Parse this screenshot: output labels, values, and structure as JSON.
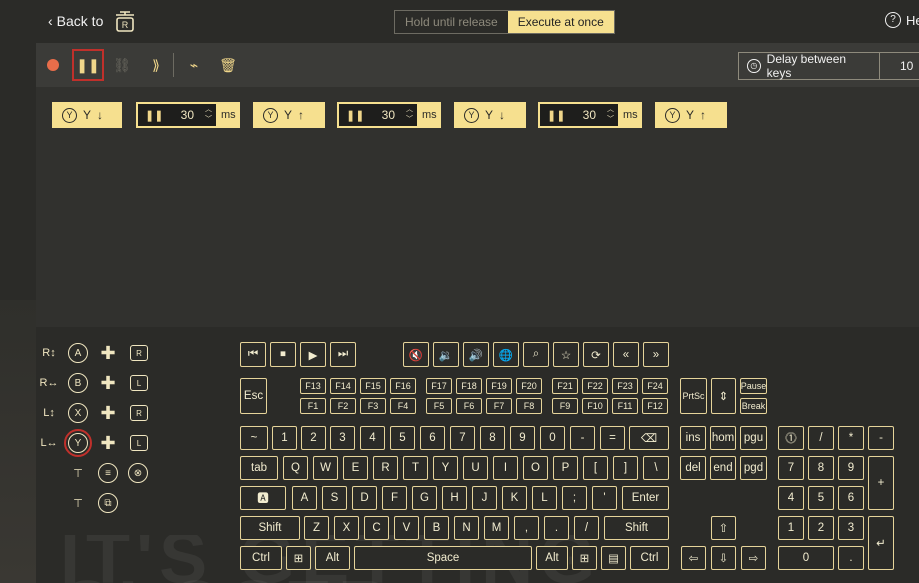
{
  "header": {
    "back_label": "Back to",
    "help_label": "He",
    "mode_options": [
      "Hold until release",
      "Execute at once"
    ],
    "mode_selected": "Execute at once"
  },
  "toolbar": {
    "delay_label": "Delay between keys",
    "delay_value": "10"
  },
  "sequence": [
    {
      "type": "key",
      "button": "Y",
      "label": "Y",
      "arrow": "↓"
    },
    {
      "type": "wait",
      "value": "30",
      "unit": "ms"
    },
    {
      "type": "key",
      "button": "Y",
      "label": "Y",
      "arrow": "↑"
    },
    {
      "type": "wait",
      "value": "30",
      "unit": "ms"
    },
    {
      "type": "key",
      "button": "Y",
      "label": "Y",
      "arrow": "↓"
    },
    {
      "type": "wait",
      "value": "30",
      "unit": "ms"
    },
    {
      "type": "key",
      "button": "Y",
      "label": "Y",
      "arrow": "↑"
    }
  ],
  "controller": {
    "face_buttons": [
      "A",
      "B",
      "X",
      "Y"
    ],
    "bumper_labels": [
      "R",
      "L",
      "R",
      "L"
    ],
    "trigger_labels": [
      "R",
      "R",
      "L",
      "L"
    ]
  },
  "keyboard": {
    "fn_row1": [
      "F13",
      "F14",
      "F15",
      "F16",
      "F17",
      "F18",
      "F19",
      "F20",
      "F21",
      "F22",
      "F23",
      "F24"
    ],
    "fn_row2": [
      "F1",
      "F2",
      "F3",
      "F4",
      "F5",
      "F6",
      "F7",
      "F8",
      "F9",
      "F10",
      "F11",
      "F12"
    ],
    "esc": "Esc",
    "prtsc": "PrtSc",
    "pause": "Pause",
    "brk": "Break",
    "row_num": [
      "~",
      "1",
      "2",
      "3",
      "4",
      "5",
      "6",
      "7",
      "8",
      "9",
      "0",
      "-",
      "="
    ],
    "row_q": [
      "tab",
      "Q",
      "W",
      "E",
      "R",
      "T",
      "Y",
      "U",
      "I",
      "O",
      "P",
      "[",
      "]",
      "\\"
    ],
    "row_a": [
      "A",
      "S",
      "D",
      "F",
      "G",
      "H",
      "J",
      "K",
      "L",
      ";",
      "'",
      "Enter"
    ],
    "row_z": [
      "Shift",
      "Z",
      "X",
      "C",
      "V",
      "B",
      "N",
      "M",
      ",",
      ".",
      "/",
      "Shift"
    ],
    "row_bottom": [
      "Ctrl",
      "Alt",
      "Space",
      "Alt",
      "Ctrl"
    ],
    "nav1": [
      "ins",
      "hom",
      "pgu"
    ],
    "nav2": [
      "del",
      "end",
      "pgd"
    ],
    "numpad": [
      "/",
      "*",
      "-",
      "7",
      "8",
      "9",
      "+",
      "4",
      "5",
      "6",
      "1",
      "2",
      "3",
      "0",
      "."
    ],
    "deco_text": "IT'S GETTING CLOSER"
  }
}
